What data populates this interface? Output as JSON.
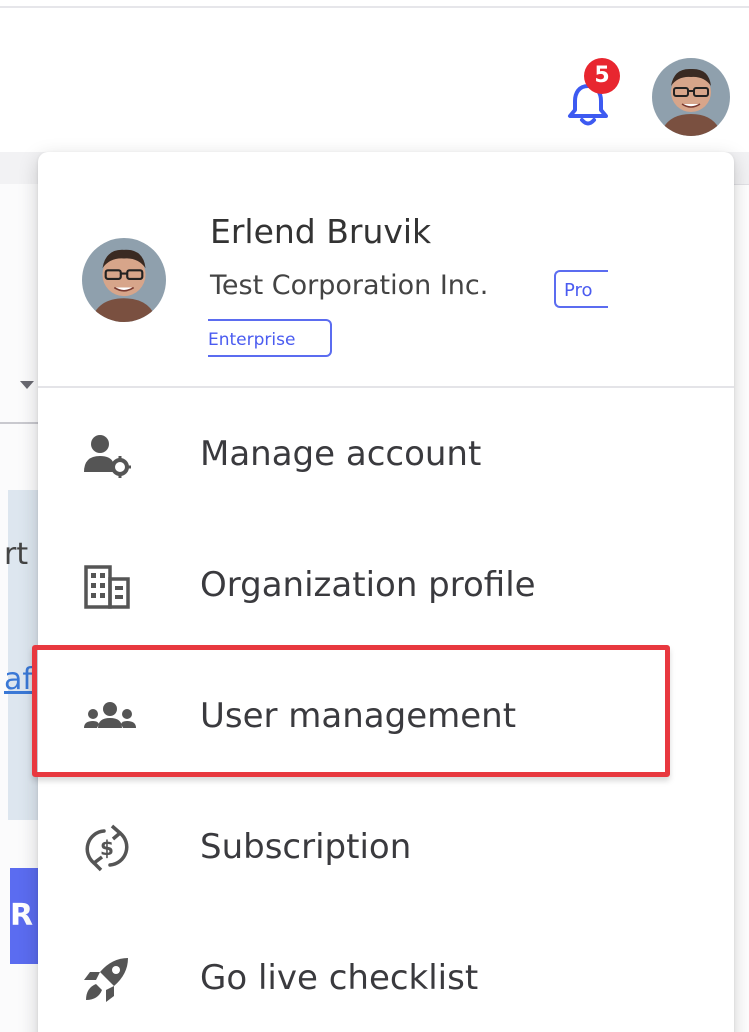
{
  "header": {
    "notifications": {
      "icon": "bell-icon",
      "count": "5",
      "accent": "#3d5af1",
      "badge_color": "#e8262f"
    },
    "avatar": {
      "icon": "user-avatar"
    }
  },
  "background": {
    "partial_text": "rt",
    "partial_link": "af",
    "partial_button": "R"
  },
  "profile": {
    "name": "Erlend Bruvik",
    "company": "Test Corporation Inc.",
    "plan_badge_line1": "Pro",
    "plan_badge_line2": "Enterprise",
    "badge_color": "#4a5bf0"
  },
  "menu": {
    "items": [
      {
        "label": "Manage account",
        "icon": "user-gear-icon"
      },
      {
        "label": "Organization profile",
        "icon": "building-icon"
      },
      {
        "label": "User management",
        "icon": "users-icon",
        "highlighted": true
      },
      {
        "label": "Subscription",
        "icon": "dollar-cycle-icon"
      },
      {
        "label": "Go live checklist",
        "icon": "rocket-icon"
      }
    ],
    "highlight_color": "#e8383f"
  }
}
